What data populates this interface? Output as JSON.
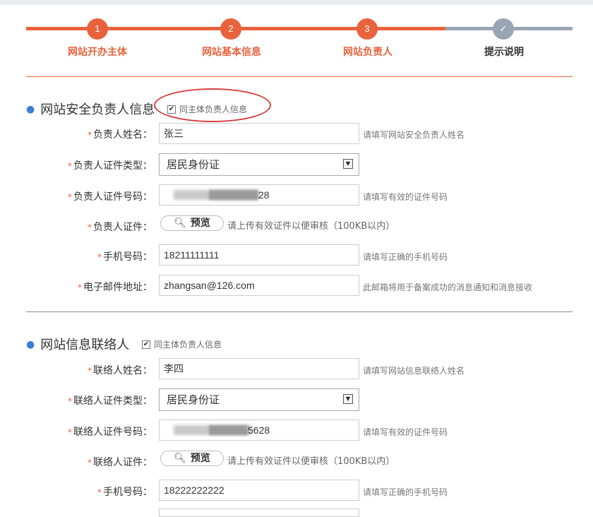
{
  "steps": [
    {
      "number": "1",
      "label": "网站开办主体"
    },
    {
      "number": "2",
      "label": "网站基本信息"
    },
    {
      "number": "3",
      "label": "网站负责人"
    },
    {
      "number": "✓",
      "label": "提示说明"
    }
  ],
  "colors": {
    "accent": "#e8633d",
    "inactive": "#9aa5b4",
    "link_dot": "#3a7fd5",
    "annotation": "#d73c3c"
  },
  "security_section": {
    "title": "网站安全负责人信息",
    "same_as_owner": "同主体负责人信息",
    "same_checked": true,
    "fields": {
      "name_label": "负责人姓名：",
      "name_value": "张三",
      "name_hint": "请填写网站安全负责人姓名",
      "id_type_label": "负责人证件类型：",
      "id_type_value": "居民身份证",
      "id_number_label": "负责人证件号码：",
      "id_number_visible_suffix": "28",
      "id_number_hint": "请填写有效的证件号码",
      "id_doc_label": "负责人证件：",
      "preview_button": "预览",
      "upload_hint": "请上传有效证件以便审核（100KB以内）",
      "phone_label": "手机号码：",
      "phone_value": "18211111111",
      "phone_hint": "请填写正确的手机号码",
      "email_label": "电子邮件地址：",
      "email_value": "zhangsan@126.com",
      "email_hint": "此邮箱将用于备案成功的消息通知和消息接收"
    }
  },
  "contact_section": {
    "title": "网站信息联络人",
    "same_as_owner": "同主体负责人信息",
    "same_checked": true,
    "fields": {
      "name_label": "联络人姓名：",
      "name_value": "李四",
      "name_hint": "请填写网站信息联络人姓名",
      "id_type_label": "联络人证件类型：",
      "id_type_value": "居民身份证",
      "id_number_label": "联络人证件号码：",
      "id_number_visible_suffix": "5628",
      "id_number_hint": "请填写有效的证件号码",
      "id_doc_label": "联络人证件：",
      "preview_button": "预览",
      "upload_hint": "请上传有效证件以便审核（100KB以内）",
      "phone_label": "手机号码：",
      "phone_value": "18222222222",
      "phone_hint": "请填写正确的手机号码"
    }
  },
  "icons": {
    "checkbox": "✔",
    "select_arrow": "▼",
    "magnifier": "🔍︎",
    "required": "*",
    "bullet": "●"
  }
}
